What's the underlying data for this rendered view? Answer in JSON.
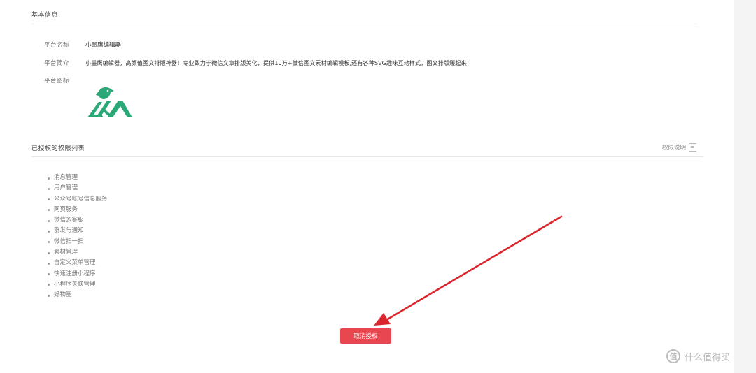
{
  "basic_info": {
    "title": "基本信息",
    "fields": [
      {
        "label": "平台名称",
        "value": "小墨鹰编辑器"
      },
      {
        "label": "平台简介",
        "value": "小墨鹰编辑器，高颜值图文排版神器！专业致力于微信文章排版美化，提供10万+微信图文素材编辑模板,还有各种SVG趣味互动样式，图文排版爆起来！"
      },
      {
        "label": "平台图标",
        "value": ""
      }
    ]
  },
  "permissions": {
    "title": "已授权的权限列表",
    "help_label": "权限说明",
    "items": [
      "消息管理",
      "用户管理",
      "公众号帐号信息服务",
      "网页服务",
      "微信多客服",
      "群发与通知",
      "微信扫一扫",
      "素材管理",
      "自定义菜单管理",
      "快速注册小程序",
      "小程序关联管理",
      "好物圈"
    ]
  },
  "actions": {
    "cancel_auth_label": "取消授权"
  },
  "watermark": {
    "icon_glyph": "值",
    "text": "什么值得买"
  },
  "colors": {
    "accent_red": "#e8474f",
    "logo_green": "#2aa876",
    "arrow_red": "#d9252b"
  }
}
